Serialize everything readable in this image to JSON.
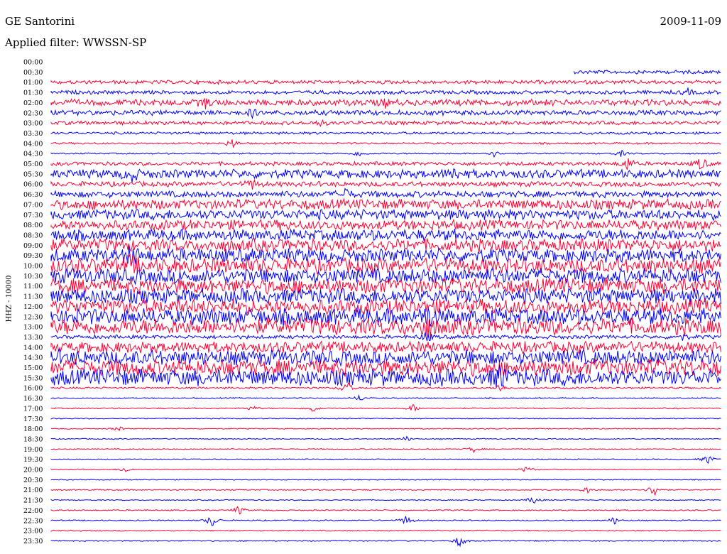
{
  "header": {
    "station": "GE Santorini",
    "date": "2009-11-09",
    "filter_label": "Applied filter: WWSSN-SP"
  },
  "chart_data": {
    "type": "line",
    "title": "GE Santorini",
    "ylabel": "HHZ - 10000",
    "trace_colors": [
      "#ff0033",
      "#0000ff"
    ],
    "rows": [
      {
        "label": "00:00",
        "amp": 0,
        "start": 1.0,
        "events": []
      },
      {
        "label": "00:30",
        "amp": 3,
        "start": 0.78,
        "events": []
      },
      {
        "label": "01:00",
        "amp": 3,
        "start": 0,
        "events": []
      },
      {
        "label": "01:30",
        "amp": 3,
        "start": 0,
        "events": [
          [
            0.95,
            4
          ]
        ]
      },
      {
        "label": "02:00",
        "amp": 5,
        "start": 0,
        "events": [
          [
            0.23,
            7
          ],
          [
            0.5,
            5
          ]
        ]
      },
      {
        "label": "02:30",
        "amp": 4,
        "start": 0,
        "events": [
          [
            0.3,
            5
          ]
        ]
      },
      {
        "label": "03:00",
        "amp": 3,
        "start": 0,
        "events": [
          [
            0.4,
            5
          ]
        ]
      },
      {
        "label": "03:30",
        "amp": 2,
        "start": 0,
        "events": []
      },
      {
        "label": "04:00",
        "amp": 1.5,
        "start": 0,
        "events": [
          [
            0.27,
            8
          ]
        ]
      },
      {
        "label": "04:30",
        "amp": 1.2,
        "start": 0,
        "events": [
          [
            0.46,
            5
          ],
          [
            0.66,
            5
          ],
          [
            0.85,
            5
          ]
        ]
      },
      {
        "label": "05:00",
        "amp": 3,
        "start": 0,
        "events": [
          [
            0.86,
            10
          ],
          [
            0.97,
            10
          ]
        ]
      },
      {
        "label": "05:30",
        "amp": 7,
        "start": 0,
        "events": [
          [
            0.12,
            10
          ],
          [
            0.6,
            9
          ]
        ]
      },
      {
        "label": "06:00",
        "amp": 4,
        "start": 0,
        "events": [
          [
            0.3,
            7
          ]
        ]
      },
      {
        "label": "06:30",
        "amp": 5,
        "start": 0,
        "events": [
          [
            0.44,
            8
          ]
        ]
      },
      {
        "label": "07:00",
        "amp": 8,
        "start": 0,
        "events": []
      },
      {
        "label": "07:30",
        "amp": 8,
        "start": 0,
        "events": []
      },
      {
        "label": "08:00",
        "amp": 8,
        "start": 0,
        "events": []
      },
      {
        "label": "08:30",
        "amp": 9,
        "start": 0,
        "events": []
      },
      {
        "label": "09:00",
        "amp": 10,
        "start": 0,
        "events": []
      },
      {
        "label": "09:30",
        "amp": 11,
        "start": 0,
        "events": [
          [
            0.12,
            14
          ]
        ]
      },
      {
        "label": "10:00",
        "amp": 12,
        "start": 0,
        "events": [
          [
            0.12,
            14
          ]
        ]
      },
      {
        "label": "10:30",
        "amp": 12,
        "start": 0,
        "events": []
      },
      {
        "label": "11:00",
        "amp": 12,
        "start": 0,
        "events": []
      },
      {
        "label": "11:30",
        "amp": 12,
        "start": 0,
        "events": []
      },
      {
        "label": "12:00",
        "amp": 12,
        "start": 0,
        "events": []
      },
      {
        "label": "12:30",
        "amp": 13,
        "start": 0,
        "events": [
          [
            0.56,
            16
          ]
        ]
      },
      {
        "label": "13:00",
        "amp": 13,
        "start": 0,
        "events": [
          [
            0.56,
            16
          ]
        ]
      },
      {
        "label": "13:30",
        "amp": 3,
        "start": 0,
        "events": [
          [
            0.56,
            8
          ],
          [
            0.94,
            6
          ]
        ]
      },
      {
        "label": "14:00",
        "amp": 9,
        "start": 0,
        "events": []
      },
      {
        "label": "14:30",
        "amp": 12,
        "start": 0,
        "events": []
      },
      {
        "label": "15:00",
        "amp": 13,
        "start": 0,
        "events": []
      },
      {
        "label": "15:30",
        "amp": 13,
        "start": 0,
        "events": [
          [
            0.67,
            16
          ]
        ]
      },
      {
        "label": "16:00",
        "amp": 1.5,
        "start": 0,
        "events": [
          [
            0.44,
            12
          ],
          [
            0.67,
            8
          ]
        ]
      },
      {
        "label": "16:30",
        "amp": 1,
        "start": 0,
        "events": [
          [
            0.46,
            5
          ]
        ]
      },
      {
        "label": "17:00",
        "amp": 1,
        "start": 0,
        "events": [
          [
            0.3,
            4
          ],
          [
            0.39,
            6
          ],
          [
            0.54,
            6
          ]
        ]
      },
      {
        "label": "17:30",
        "amp": 0.8,
        "start": 0,
        "events": []
      },
      {
        "label": "18:00",
        "amp": 0.8,
        "start": 0,
        "events": [
          [
            0.1,
            4
          ]
        ]
      },
      {
        "label": "18:30",
        "amp": 0.8,
        "start": 0,
        "events": [
          [
            0.53,
            4
          ]
        ]
      },
      {
        "label": "19:00",
        "amp": 0.8,
        "start": 0,
        "events": [
          [
            0.63,
            5
          ]
        ]
      },
      {
        "label": "19:30",
        "amp": 0.8,
        "start": 0,
        "events": [
          [
            0.98,
            8
          ]
        ]
      },
      {
        "label": "20:00",
        "amp": 0.8,
        "start": 0,
        "events": [
          [
            0.11,
            5
          ],
          [
            0.71,
            5
          ]
        ]
      },
      {
        "label": "20:30",
        "amp": 0.8,
        "start": 0,
        "events": []
      },
      {
        "label": "21:00",
        "amp": 1,
        "start": 0,
        "events": [
          [
            0.8,
            5
          ],
          [
            0.9,
            12
          ]
        ]
      },
      {
        "label": "21:30",
        "amp": 0.8,
        "start": 0,
        "events": [
          [
            0.72,
            7
          ]
        ]
      },
      {
        "label": "22:00",
        "amp": 1,
        "start": 0,
        "events": [
          [
            0.28,
            7
          ]
        ]
      },
      {
        "label": "22:30",
        "amp": 1,
        "start": 0,
        "events": [
          [
            0.24,
            10
          ],
          [
            0.53,
            8
          ],
          [
            0.84,
            6
          ]
        ]
      },
      {
        "label": "23:00",
        "amp": 1,
        "start": 0,
        "events": []
      },
      {
        "label": "23:30",
        "amp": 1,
        "start": 0,
        "events": [
          [
            0.61,
            10
          ]
        ]
      }
    ]
  }
}
